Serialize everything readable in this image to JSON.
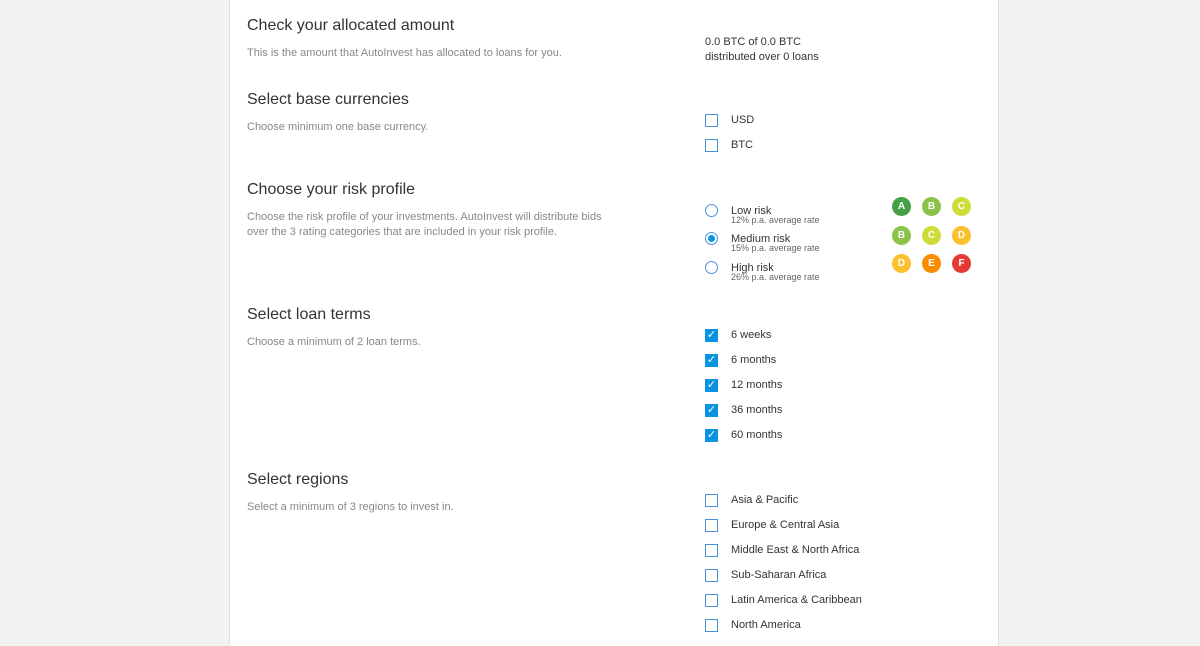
{
  "allocated": {
    "title": "Check your allocated amount",
    "description": "This is the amount that AutoInvest has allocated to loans for you.",
    "amount_line": "0.0 BTC of 0.0 BTC",
    "loans_line": "distributed over 0 loans"
  },
  "currencies": {
    "title": "Select base currencies",
    "description": "Choose minimum one base currency.",
    "options": [
      {
        "label": "USD",
        "checked": false
      },
      {
        "label": "BTC",
        "checked": false
      }
    ]
  },
  "risk": {
    "title": "Choose your risk profile",
    "description": "Choose the risk profile of your investments. AutoInvest will distribute bids over the 3 rating categories that are included in your risk profile.",
    "options": [
      {
        "label": "Low risk",
        "rate": "12% p.a. average rate",
        "selected": false,
        "ratings": [
          {
            "letter": "A",
            "color": "#43a047"
          },
          {
            "letter": "B",
            "color": "#8bc34a"
          },
          {
            "letter": "C",
            "color": "#cddc39"
          }
        ]
      },
      {
        "label": "Medium risk",
        "rate": "15% p.a. average rate",
        "selected": true,
        "ratings": [
          {
            "letter": "B",
            "color": "#8bc34a"
          },
          {
            "letter": "C",
            "color": "#cddc39"
          },
          {
            "letter": "D",
            "color": "#fbc02d"
          }
        ]
      },
      {
        "label": "High risk",
        "rate": "26% p.a. average rate",
        "selected": false,
        "ratings": [
          {
            "letter": "D",
            "color": "#fbc02d"
          },
          {
            "letter": "E",
            "color": "#fb8c00"
          },
          {
            "letter": "F",
            "color": "#e53935"
          }
        ]
      }
    ]
  },
  "terms": {
    "title": "Select loan terms",
    "description": "Choose a minimum of 2 loan terms.",
    "options": [
      {
        "label": "6 weeks",
        "checked": true
      },
      {
        "label": "6 months",
        "checked": true
      },
      {
        "label": "12 months",
        "checked": true
      },
      {
        "label": "36 months",
        "checked": true
      },
      {
        "label": "60 months",
        "checked": true
      }
    ]
  },
  "regions": {
    "title": "Select regions",
    "description": "Select a minimum of 3 regions to invest in.",
    "options": [
      {
        "label": "Asia & Pacific",
        "checked": false
      },
      {
        "label": "Europe & Central Asia",
        "checked": false
      },
      {
        "label": "Middle East & North Africa",
        "checked": false
      },
      {
        "label": "Sub-Saharan Africa",
        "checked": false
      },
      {
        "label": "Latin America & Caribbean",
        "checked": false
      },
      {
        "label": "North America",
        "checked": false
      }
    ]
  }
}
